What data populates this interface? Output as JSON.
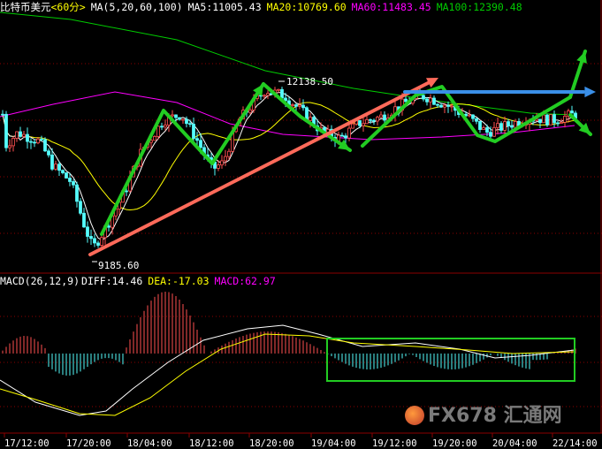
{
  "header": {
    "symbol": "比特币美元",
    "period": "<60分>",
    "ma_label": "MA(5,20,60,100)",
    "ma5": "MA5:11005.43",
    "ma20": "MA20:10769.60",
    "ma60": "MA60:11483.45",
    "ma100": "MA100:12390.48"
  },
  "macd_header": {
    "label": "MACD(26,12,9)",
    "diff": "DIFF:14.46",
    "dea": "DEA:-17.03",
    "macd": "MACD:62.97"
  },
  "annotations": {
    "high": "12138.50",
    "low": "9185.60"
  },
  "watermark": {
    "text": "FX678",
    "cn": "汇通网"
  },
  "colors": {
    "bg": "#000000",
    "up": "#ff5050",
    "down": "#54fcfc",
    "ma5": "#ffffff",
    "ma20": "#ffff00",
    "ma60": "#ff00ff",
    "ma100": "#00cc00",
    "arrow_green": "#22cc22",
    "arrow_red": "#ff6a5a",
    "arrow_blue": "#3a8fe8",
    "grid": "#8b0000"
  },
  "chart_data": {
    "type": "candlestick",
    "x_ticks": [
      "17/12:00",
      "17/20:00",
      "18/04:00",
      "18/12:00",
      "18/20:00",
      "19/04:00",
      "19/12:00",
      "19/20:00",
      "20/04:00",
      "22/14:00"
    ],
    "price_marks": {
      "high": 12138.5,
      "low": 9185.6
    },
    "ma_last": {
      "ma5": 11005.43,
      "ma20": 10769.6,
      "ma60": 11483.45,
      "ma100": 12390.48
    },
    "macd_last": {
      "diff": 14.46,
      "dea": -17.03,
      "macd": 62.97
    }
  }
}
